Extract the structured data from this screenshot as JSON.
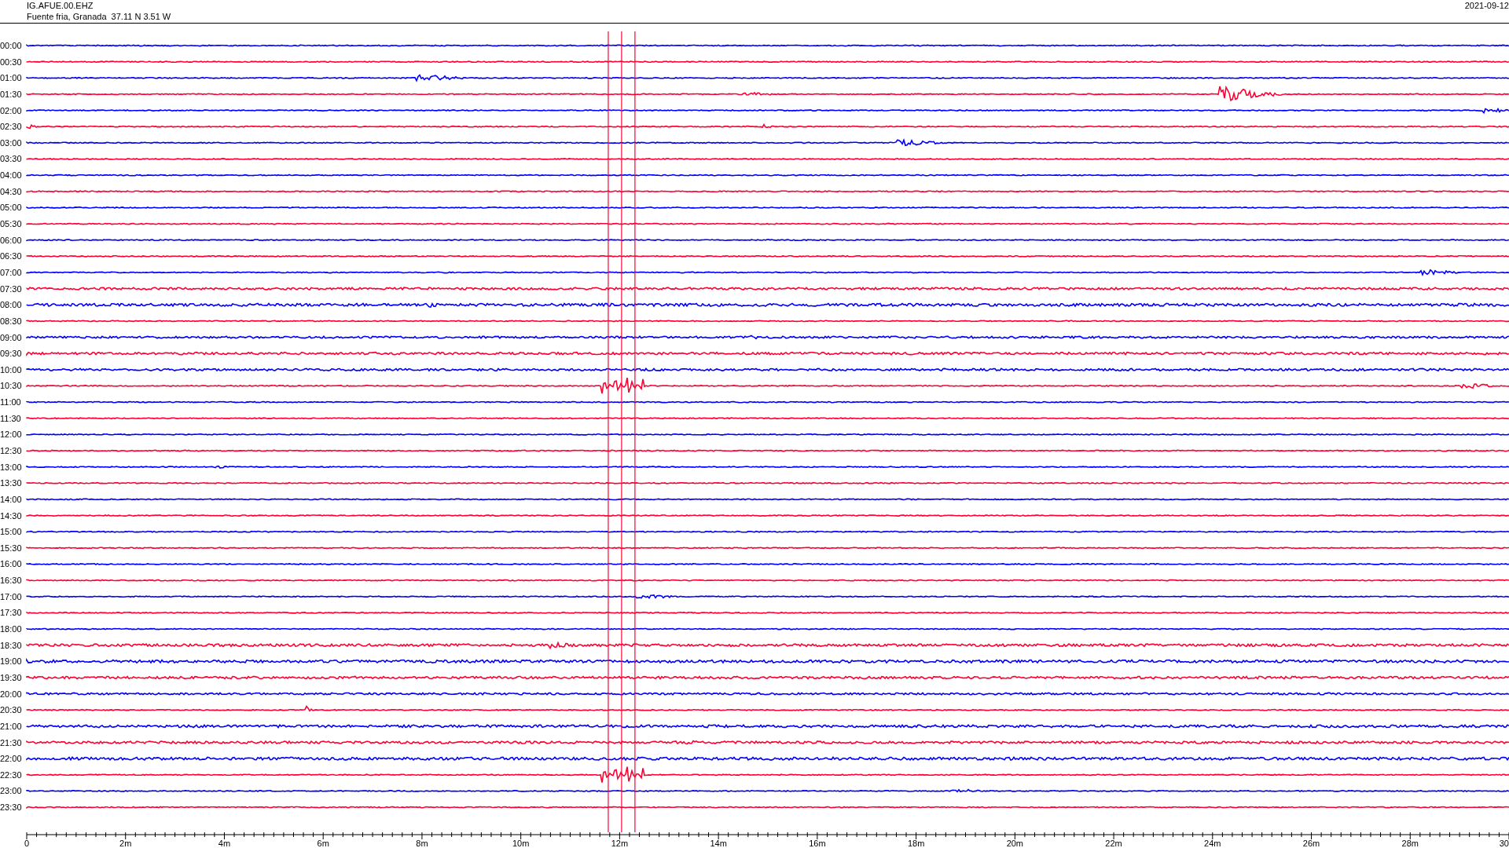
{
  "header": {
    "channel": "IG.AFUE.00.EHZ",
    "location": "Fuente fria, Granada  37.11 N 3.51 W",
    "date": "2021-09-12"
  },
  "rows": [
    {
      "label": "00:00",
      "color": "#0000ff"
    },
    {
      "label": "00:30",
      "color": "#ff0033"
    },
    {
      "label": "01:00",
      "color": "#0000ff"
    },
    {
      "label": "01:30",
      "color": "#ff0033"
    },
    {
      "label": "02:00",
      "color": "#0000ff"
    },
    {
      "label": "02:30",
      "color": "#ff0033"
    },
    {
      "label": "03:00",
      "color": "#0000ff"
    },
    {
      "label": "03:30",
      "color": "#ff0033"
    },
    {
      "label": "04:00",
      "color": "#0000ff"
    },
    {
      "label": "04:30",
      "color": "#ff0033"
    },
    {
      "label": "05:00",
      "color": "#0000ff"
    },
    {
      "label": "05:30",
      "color": "#ff0033"
    },
    {
      "label": "06:00",
      "color": "#0000ff"
    },
    {
      "label": "06:30",
      "color": "#ff0033"
    },
    {
      "label": "07:00",
      "color": "#0000ff"
    },
    {
      "label": "07:30",
      "color": "#ff0033"
    },
    {
      "label": "08:00",
      "color": "#0000ff"
    },
    {
      "label": "08:30",
      "color": "#ff0033"
    },
    {
      "label": "09:00",
      "color": "#0000ff"
    },
    {
      "label": "09:30",
      "color": "#ff0033"
    },
    {
      "label": "10:00",
      "color": "#0000ff"
    },
    {
      "label": "10:30",
      "color": "#ff0033"
    },
    {
      "label": "11:00",
      "color": "#0000ff"
    },
    {
      "label": "11:30",
      "color": "#ff0033"
    },
    {
      "label": "12:00",
      "color": "#0000ff"
    },
    {
      "label": "12:30",
      "color": "#ff0033"
    },
    {
      "label": "13:00",
      "color": "#0000ff"
    },
    {
      "label": "13:30",
      "color": "#ff0033"
    },
    {
      "label": "14:00",
      "color": "#0000ff"
    },
    {
      "label": "14:30",
      "color": "#ff0033"
    },
    {
      "label": "15:00",
      "color": "#0000ff"
    },
    {
      "label": "15:30",
      "color": "#ff0033"
    },
    {
      "label": "16:00",
      "color": "#0000ff"
    },
    {
      "label": "16:30",
      "color": "#ff0033"
    },
    {
      "label": "17:00",
      "color": "#0000ff"
    },
    {
      "label": "17:30",
      "color": "#ff0033"
    },
    {
      "label": "18:00",
      "color": "#0000ff"
    },
    {
      "label": "18:30",
      "color": "#ff0033"
    },
    {
      "label": "19:00",
      "color": "#0000ff"
    },
    {
      "label": "19:30",
      "color": "#ff0033"
    },
    {
      "label": "20:00",
      "color": "#0000ff"
    },
    {
      "label": "20:30",
      "color": "#ff0033"
    },
    {
      "label": "21:00",
      "color": "#0000ff"
    },
    {
      "label": "21:30",
      "color": "#ff0033"
    },
    {
      "label": "22:00",
      "color": "#0000ff"
    },
    {
      "label": "22:30",
      "color": "#ff0033"
    },
    {
      "label": "23:00",
      "color": "#0000ff"
    },
    {
      "label": "23:30",
      "color": "#ff0033"
    }
  ],
  "x_axis": {
    "ticks": [
      "0",
      "2m",
      "4m",
      "6m",
      "8m",
      "10m",
      "12m",
      "14m",
      "16m",
      "18m",
      "20m",
      "22m",
      "24m",
      "26m",
      "28m",
      "30"
    ]
  }
}
